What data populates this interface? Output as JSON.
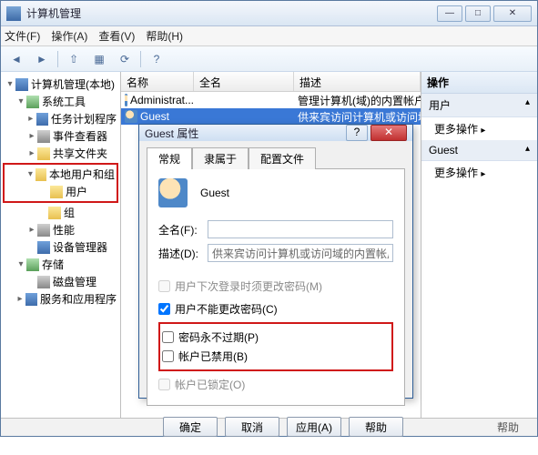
{
  "window": {
    "title": "计算机管理",
    "btn_min": "—",
    "btn_max": "□",
    "btn_close": "✕"
  },
  "menu": {
    "file": "文件(F)",
    "action": "操作(A)",
    "view": "查看(V)",
    "help": "帮助(H)"
  },
  "tree": {
    "root": "计算机管理(本地)",
    "sys_tools": "系统工具",
    "task_sched": "任务计划程序",
    "event_viewer": "事件查看器",
    "shared": "共享文件夹",
    "local_users": "本地用户和组",
    "users": "用户",
    "groups": "组",
    "perf": "性能",
    "devmgr": "设备管理器",
    "storage": "存储",
    "diskmgr": "磁盘管理",
    "services": "服务和应用程序"
  },
  "list": {
    "col_name": "名称",
    "col_full": "全名",
    "col_desc": "描述",
    "rows": [
      {
        "name": "Administrat...",
        "full": "",
        "desc": "管理计算机(域)的内置帐户"
      },
      {
        "name": "Guest",
        "full": "",
        "desc": "供来宾访问计算机或访问域的内"
      }
    ]
  },
  "actions": {
    "header": "操作",
    "group1": "用户",
    "more1": "更多操作",
    "group2": "Guest",
    "more2": "更多操作"
  },
  "dialog": {
    "title": "Guest 属性",
    "btn_help": "?",
    "btn_close": "✕",
    "tabs": {
      "general": "常规",
      "member": "隶属于",
      "profile": "配置文件"
    },
    "account_name": "Guest",
    "label_full": "全名(F):",
    "value_full": "",
    "label_desc": "描述(D):",
    "value_desc": "供来宾访问计算机或访问域的内置帐户",
    "chk_mustchange": "用户下次登录时须更改密码(M)",
    "chk_cannot": "用户不能更改密码(C)",
    "chk_noexpire": "密码永不过期(P)",
    "chk_disabled": "帐户已禁用(B)",
    "chk_locked": "帐户已锁定(O)",
    "btns": {
      "ok": "确定",
      "cancel": "取消",
      "apply": "应用(A)",
      "help": "帮助"
    }
  },
  "status": "帮助"
}
